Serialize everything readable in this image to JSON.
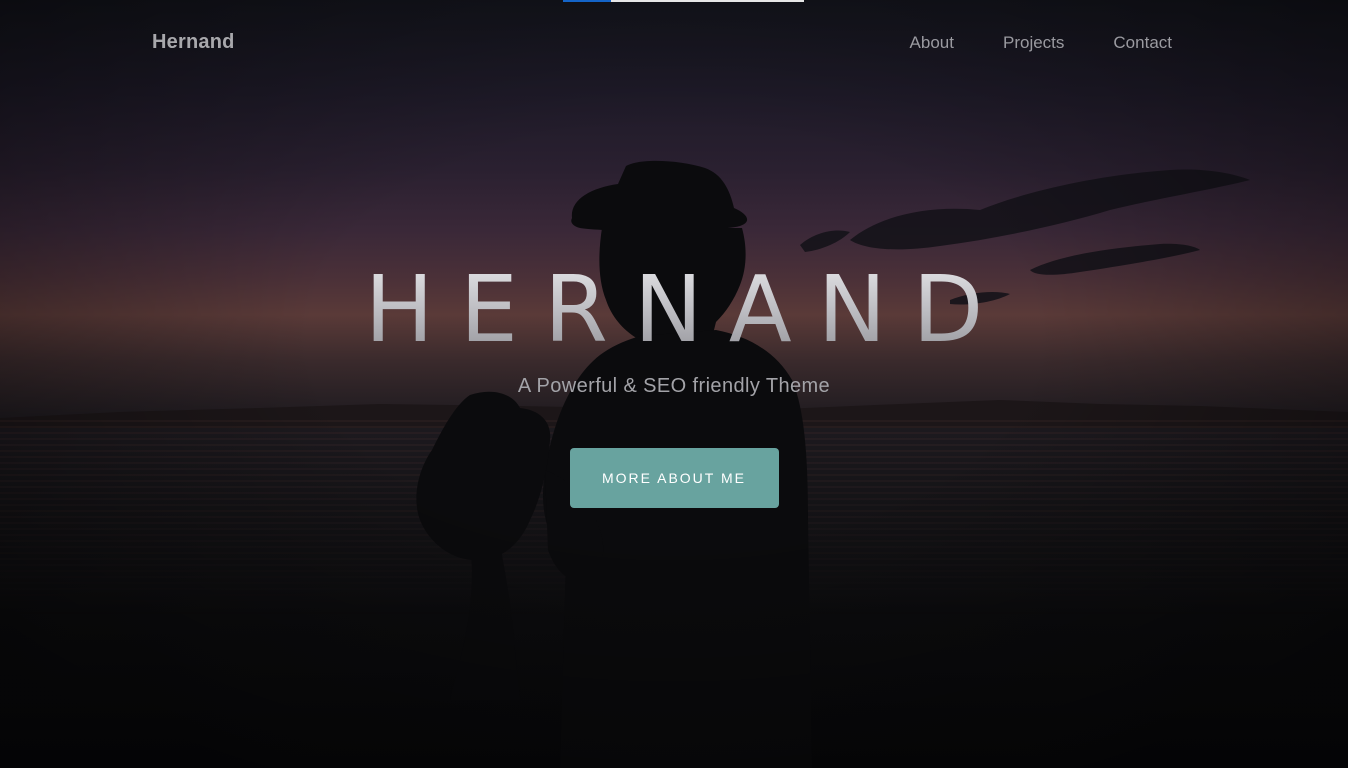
{
  "progress": {
    "value": 0.2
  },
  "header": {
    "brand": "Hernand",
    "nav": [
      "About",
      "Projects",
      "Contact"
    ]
  },
  "hero": {
    "title": "HERNAND",
    "subtitle": "A Powerful & SEO friendly Theme",
    "cta_label": "MORE ABOUT ME",
    "cta_color": "#68a39f"
  }
}
